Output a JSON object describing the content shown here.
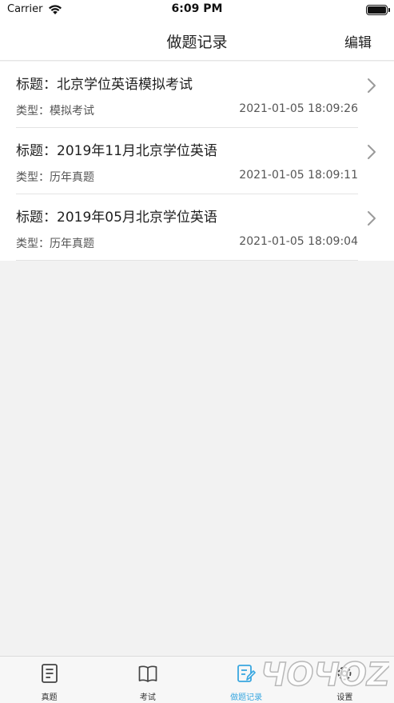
{
  "status_bar": {
    "carrier": "Carrier",
    "time": "6:09 PM",
    "battery_level": 1.0
  },
  "nav": {
    "title": "做题记录",
    "edit_label": "编辑"
  },
  "records": [
    {
      "title": "标题：北京学位英语模拟考试",
      "type": "类型：模拟考试",
      "time": "2021-01-05 18:09:26"
    },
    {
      "title": "标题：2019年11月北京学位英语",
      "type": "类型：历年真题",
      "time": "2021-01-05 18:09:11"
    },
    {
      "title": "标题：2019年05月北京学位英语",
      "type": "类型：历年真题",
      "time": "2021-01-05 18:09:04"
    }
  ],
  "tabs": [
    {
      "label": "真题",
      "icon": "document-icon",
      "active": false
    },
    {
      "label": "考试",
      "icon": "book-icon",
      "active": false
    },
    {
      "label": "做题记录",
      "icon": "edit-record-icon",
      "active": true
    },
    {
      "label": "设置",
      "icon": "gear-icon",
      "active": false
    }
  ],
  "colors": {
    "accent": "#39a7e0",
    "background": "#f2f2f2",
    "text": "#222222"
  },
  "watermark": {
    "text": "ЧОЧОZ"
  }
}
